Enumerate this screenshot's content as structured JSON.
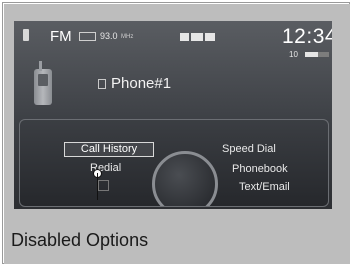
{
  "status_bar": {
    "band": "FM",
    "frequency": "93.0",
    "unit": "MHz",
    "clock": "12:34",
    "signal_level": "10"
  },
  "phone": {
    "device_name": "Phone#1"
  },
  "menu": {
    "call_history": "Call History",
    "redial": "Redial",
    "speed_dial": "Speed Dial",
    "phonebook": "Phonebook",
    "text_email": "Text/Email"
  },
  "annotation": {
    "label": "Disabled Options"
  },
  "icons": [
    "phone-status-icon",
    "rds-icon",
    "handset-icon",
    "phone-icon"
  ]
}
